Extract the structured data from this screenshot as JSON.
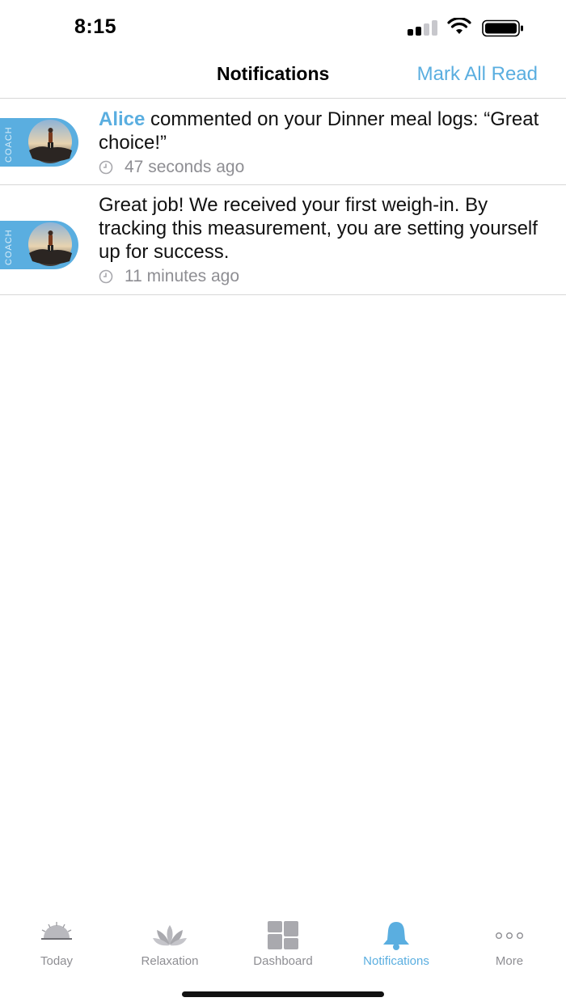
{
  "status_bar": {
    "time": "8:15"
  },
  "header": {
    "title": "Notifications",
    "mark_all_read": "Mark All Read"
  },
  "notifications": [
    {
      "author": "Alice",
      "message": " commented on your Dinner meal logs: “Great choice!”",
      "time_ago": "47 seconds ago",
      "avatar_label": "COACH",
      "avatar_icon": "coach-avatar-icon"
    },
    {
      "author": "",
      "message": "Great job!  We received your first weigh-in. By tracking this measurement, you are setting yourself up for success.",
      "time_ago": "11 minutes ago",
      "avatar_label": "COACH",
      "avatar_icon": "coach-avatar-icon"
    }
  ],
  "tab_bar": {
    "items": [
      {
        "label": "Today",
        "icon": "sunrise-icon",
        "active": false
      },
      {
        "label": "Relaxation",
        "icon": "lotus-icon",
        "active": false
      },
      {
        "label": "Dashboard",
        "icon": "dashboard-grid-icon",
        "active": false
      },
      {
        "label": "Notifications",
        "icon": "bell-icon",
        "active": true
      },
      {
        "label": "More",
        "icon": "more-dots-icon",
        "active": false
      }
    ]
  },
  "colors": {
    "accent": "#5aaee0",
    "inactive": "#8e8e93",
    "divider": "#d7d7d7"
  }
}
